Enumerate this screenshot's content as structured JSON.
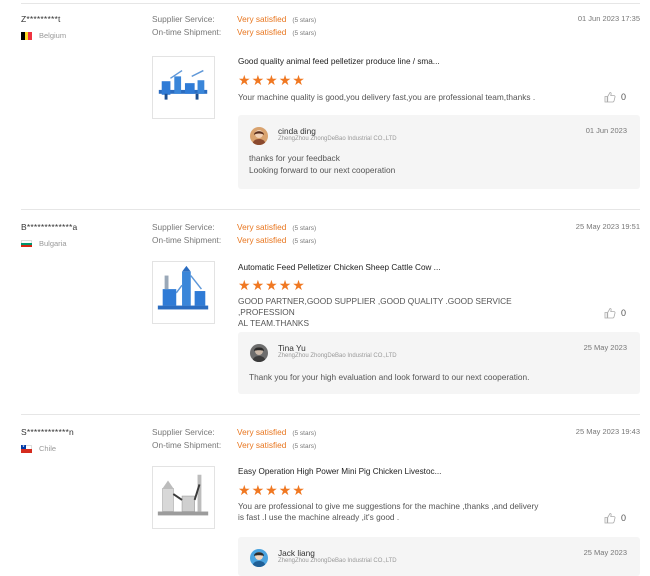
{
  "reviews": [
    {
      "buyer": "Z*********t",
      "country": "Belgium",
      "flag": [
        "#000000",
        "#fdda24",
        "#ef3340"
      ],
      "date": "01 Jun 2023 17:35",
      "supplier_service_label": "Supplier Service:",
      "supplier_service_value": "Very satisfied",
      "supplier_service_stars": "(5 stars)",
      "shipment_label": "On-time Shipment:",
      "shipment_value": "Very satisfied",
      "shipment_stars": "(5 stars)",
      "product_title": "Good quality animal feed pelletizer produce line / sma...",
      "stars": [
        "★",
        "★",
        "★",
        "★",
        "★"
      ],
      "comment": "Your machine quality is good,you delivery fast,you are professional team,thanks .",
      "likes": "0",
      "reply": {
        "author": "cinda ding",
        "company": "ZhengZhou ZhongDeBao Industrial CO.,LTD",
        "date": "01 Jun 2023",
        "lines": [
          "thanks for your feedback",
          "Looking forward to our next cooperation"
        ]
      }
    },
    {
      "buyer": "B*************a",
      "country": "Bulgaria",
      "flag": [
        "#ffffff",
        "#00966e",
        "#d62612"
      ],
      "date": "25 May 2023 19:51",
      "supplier_service_label": "Supplier Service:",
      "supplier_service_value": "Very satisfied",
      "supplier_service_stars": "(5 stars)",
      "shipment_label": "On-time Shipment:",
      "shipment_value": "Very satisfied",
      "shipment_stars": "(5 stars)",
      "product_title": "Automatic Feed Pelletizer Chicken Sheep Cattle Cow ...",
      "stars": [
        "★",
        "★",
        "★",
        "★",
        "★"
      ],
      "comment_lines": [
        "GOOD PARTNER,GOOD SUPPLIER ,GOOD QUALITY .GOOD SERVICE ,PROFESSION",
        "AL TEAM.THANKS"
      ],
      "likes": "0",
      "reply": {
        "author": "Tina Yu",
        "company": "ZhengZhou ZhongDeBao Industrial CO.,LTD",
        "date": "25 May 2023",
        "lines": [
          "Thank you for your high evaluation and look forward to our next cooperation."
        ]
      }
    },
    {
      "buyer": "S************n",
      "country": "Chile",
      "flag": [
        "#ffffff",
        "#d52b1e"
      ],
      "date": "25 May 2023 19:43",
      "supplier_service_label": "Supplier Service:",
      "supplier_service_value": "Very satisfied",
      "supplier_service_stars": "(5 stars)",
      "shipment_label": "On-time Shipment:",
      "shipment_value": "Very satisfied",
      "shipment_stars": "(5 stars)",
      "product_title": "Easy Operation High Power Mini Pig Chicken Livestoc...",
      "stars": [
        "★",
        "★",
        "★",
        "★",
        "★"
      ],
      "comment_lines": [
        "You are professional to give me suggestions for the machine ,thanks ,and delivery",
        "is fast .I use the machine already ,it's good ."
      ],
      "likes": "0",
      "reply": {
        "author": "Jack liang",
        "company": "ZhengZhou ZhongDeBao Industrial CO.,LTD",
        "date": "25 May 2023"
      }
    }
  ],
  "colors": {
    "accent": "#f07822",
    "rating_text": "#e8761f",
    "reply_bg": "#f5f5f5"
  },
  "icons": {
    "like": "thumbs-up-icon",
    "chile_star": "★"
  }
}
